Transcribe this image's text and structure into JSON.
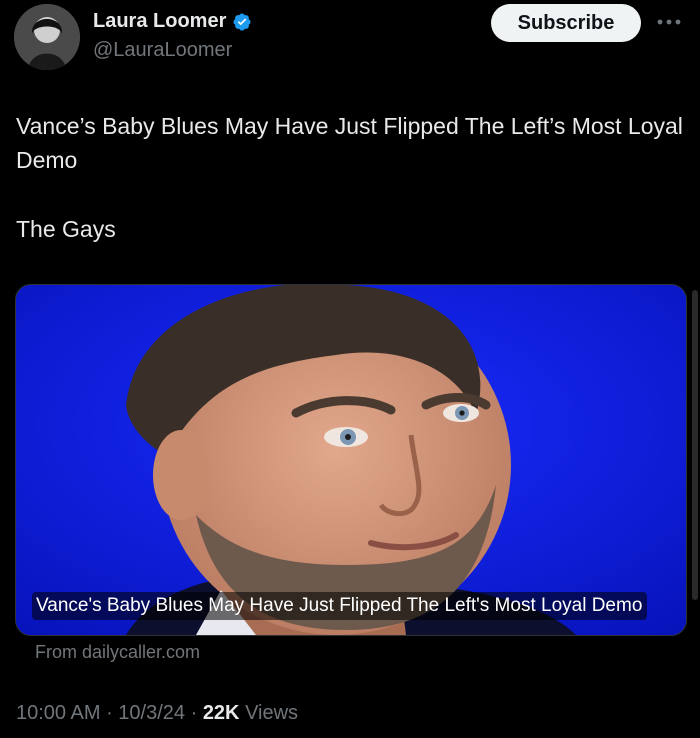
{
  "author": {
    "display_name": "Laura Loomer",
    "handle": "@LauraLoomer",
    "verified_color": "#1d9bf0"
  },
  "actions": {
    "subscribe_label": "Subscribe",
    "more_icon": "more-horizontal-icon"
  },
  "tweet": {
    "line1": "Vance’s Baby Blues May Have Just Flipped The Left’s Most Loyal Demo",
    "line2": "The Gays"
  },
  "card": {
    "caption": "Vance's Baby Blues May Have Just Flipped The Left's Most Loyal Demo",
    "source": "From dailycaller.com",
    "background_color": "#0a18e0"
  },
  "meta": {
    "time": "10:00 AM",
    "separator1": " · ",
    "date": "10/3/24",
    "separator2": " · ",
    "views_count": "22K",
    "views_label": " Views"
  }
}
